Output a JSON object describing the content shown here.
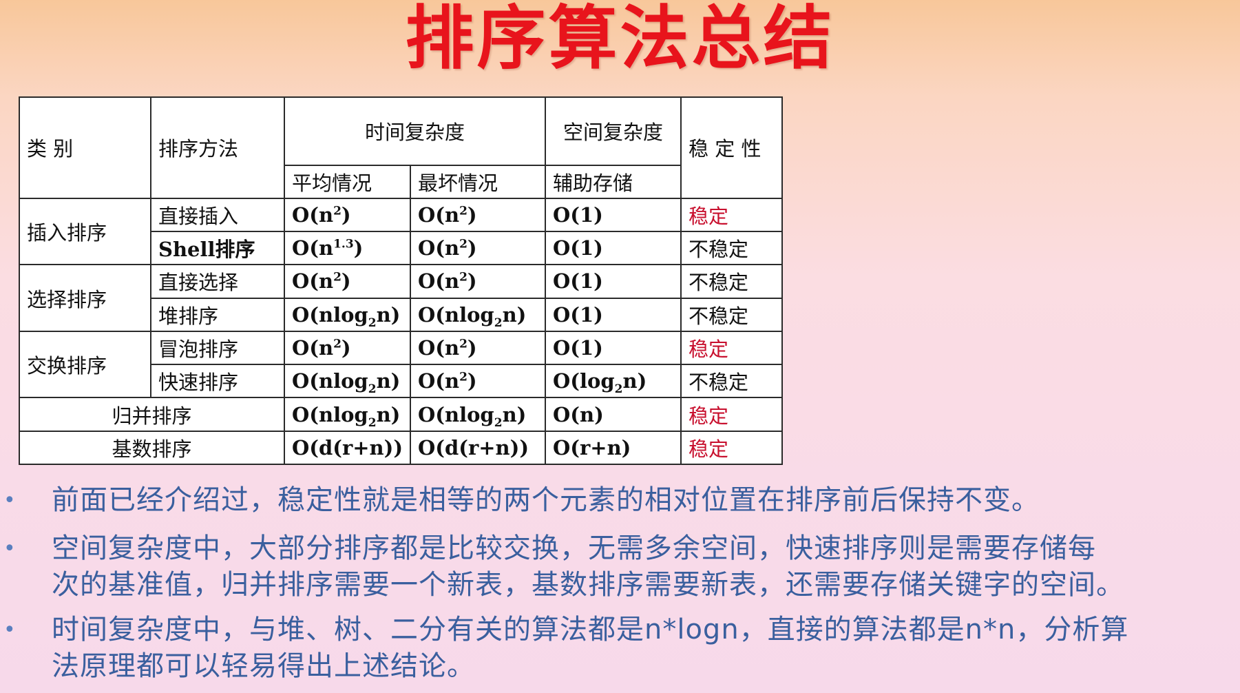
{
  "title": "排序算法总结",
  "table": {
    "headers": {
      "category": "类 别",
      "method": "排序方法",
      "time_complexity": "时间复杂度",
      "space_complexity": "空间复杂度",
      "stability": "稳 定 性",
      "average": "平均情况",
      "worst": "最坏情况",
      "auxiliary": "辅助存储"
    },
    "groups": {
      "insertion": "插入排序",
      "selection": "选择排序",
      "exchange": "交换排序"
    },
    "rows": [
      {
        "method": "直接插入",
        "avg": [
          "O(n",
          "2",
          ")"
        ],
        "worst": [
          "O(n",
          "2",
          ")"
        ],
        "space": [
          "O(1)"
        ],
        "stability": "稳定"
      },
      {
        "method": "Shell排序",
        "avg": [
          "O(n",
          "1.3",
          ")"
        ],
        "worst": [
          "O(n",
          "2",
          ")"
        ],
        "space": [
          "O(1)"
        ],
        "stability": "不稳定"
      },
      {
        "method": "直接选择",
        "avg": [
          "O(n",
          "2",
          ")"
        ],
        "worst": [
          "O(n",
          "2",
          ")"
        ],
        "space": [
          "O(1)"
        ],
        "stability": "不稳定"
      },
      {
        "method": "堆排序",
        "avg": [
          "O(nlog",
          "2",
          "n)"
        ],
        "worst": [
          "O(nlog",
          "2",
          "n)"
        ],
        "space": [
          "O(1)"
        ],
        "stability": "不稳定"
      },
      {
        "method": "冒泡排序",
        "avg": [
          "O(n",
          "2",
          ")"
        ],
        "worst": [
          "O(n",
          "2",
          ")"
        ],
        "space": [
          "O(1)"
        ],
        "stability": "稳定"
      },
      {
        "method": "快速排序",
        "avg": [
          "O(nlog",
          "2",
          "n)"
        ],
        "worst": [
          "O(n",
          "2",
          ")"
        ],
        "space": [
          "O(log",
          "2",
          "n)"
        ],
        "stability": "不稳定"
      },
      {
        "method": "归并排序",
        "avg": [
          "O(nlog",
          "2",
          "n)"
        ],
        "worst": [
          "O(nlog",
          "2",
          "n)"
        ],
        "space": [
          "O(n)"
        ],
        "stability": "稳定"
      },
      {
        "method": "基数排序",
        "avg": [
          "O(d(r+n))"
        ],
        "worst": [
          "O(d(r+n))"
        ],
        "space": [
          "O(r+n)"
        ],
        "stability": "稳定"
      }
    ]
  },
  "notes": [
    {
      "bullet": "•",
      "lines": [
        "前面已经介绍过，稳定性就是相等的两个元素的相对位置在排序前后保持不变。"
      ]
    },
    {
      "bullet": "•",
      "lines": [
        "空间复杂度中，大部分排序都是比较交换，无需多余空间，快速排序则是需要存储每",
        "次的基准值，归并排序需要一个新表，基数排序需要新表，还需要存储关键字的空间。"
      ]
    },
    {
      "bullet": "•",
      "lines": [
        "时间复杂度中，与堆、树、二分有关的算法都是n*logn，直接的算法都是n*n，分析算",
        "法原理都可以轻易得出上述结论。"
      ]
    }
  ],
  "colors": {
    "title": "#e8141c",
    "stable": "#c8102e",
    "note_text": "#3a5f9e"
  }
}
